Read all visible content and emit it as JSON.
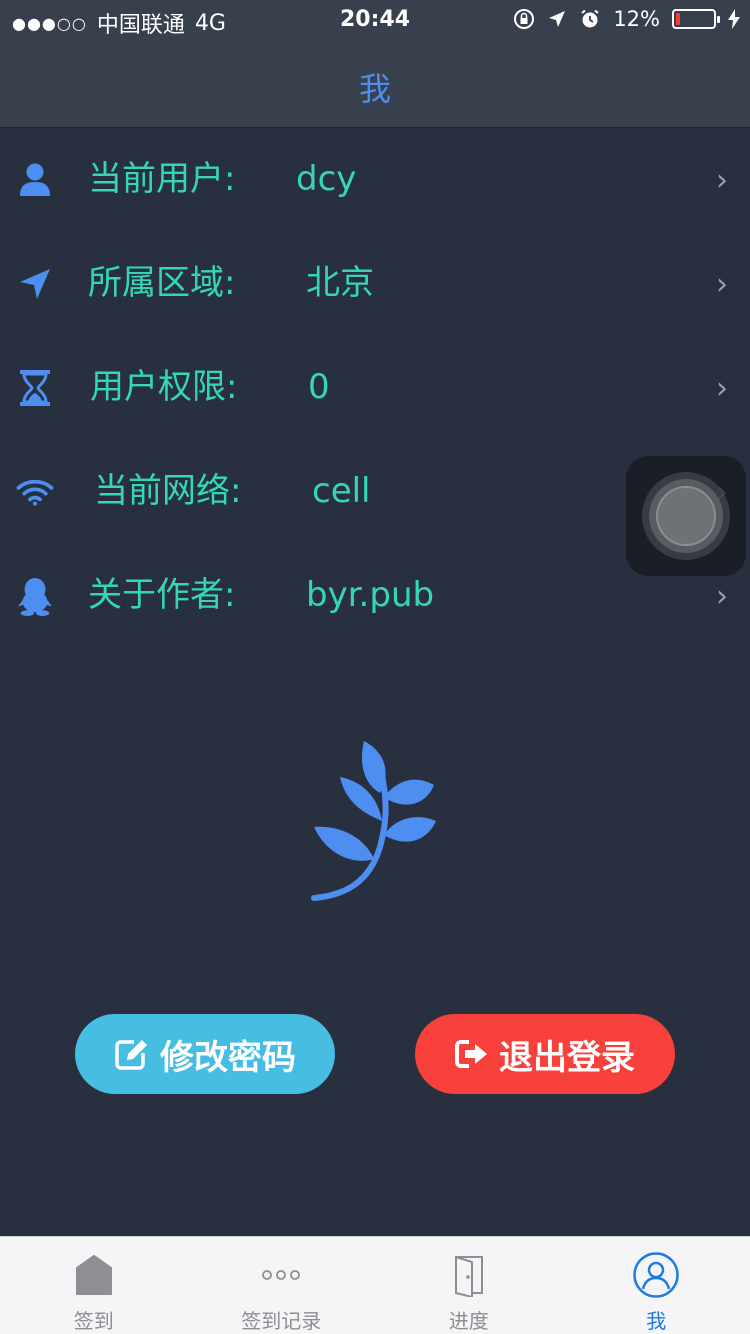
{
  "status_bar": {
    "signal": "●●●○○",
    "carrier": "中国联通",
    "network": "4G",
    "time": "20:44",
    "battery_text": "12%",
    "battery_level": 0.12
  },
  "nav": {
    "title": "我"
  },
  "rows": [
    {
      "label": "当前用户:",
      "value": "dcy",
      "icon": "user-icon"
    },
    {
      "label": "所属区域:",
      "value": "北京",
      "icon": "location-arrow-icon"
    },
    {
      "label": "用户权限:",
      "value": "0",
      "icon": "hourglass-icon"
    },
    {
      "label": "当前网络:",
      "value": "cell",
      "icon": "wifi-icon"
    },
    {
      "label": "关于作者:",
      "value": "byr.pub",
      "icon": "qq-penguin-icon"
    }
  ],
  "buttons": {
    "change_password": "修改密码",
    "logout": "退出登录"
  },
  "tabs": [
    {
      "label": "签到",
      "icon": "home-icon",
      "active": false
    },
    {
      "label": "签到记录",
      "icon": "more-dots-icon",
      "active": false
    },
    {
      "label": "进度",
      "icon": "door-icon",
      "active": false
    },
    {
      "label": "我",
      "icon": "person-circle-icon",
      "active": true
    }
  ],
  "colors": {
    "background": "#28303f",
    "nav_background": "#39404d",
    "accent_blue": "#4d8ef0",
    "text_teal": "#35d6b8",
    "button_blue": "#47bde3",
    "button_red": "#f9413b",
    "tab_active": "#1e7ae6"
  }
}
